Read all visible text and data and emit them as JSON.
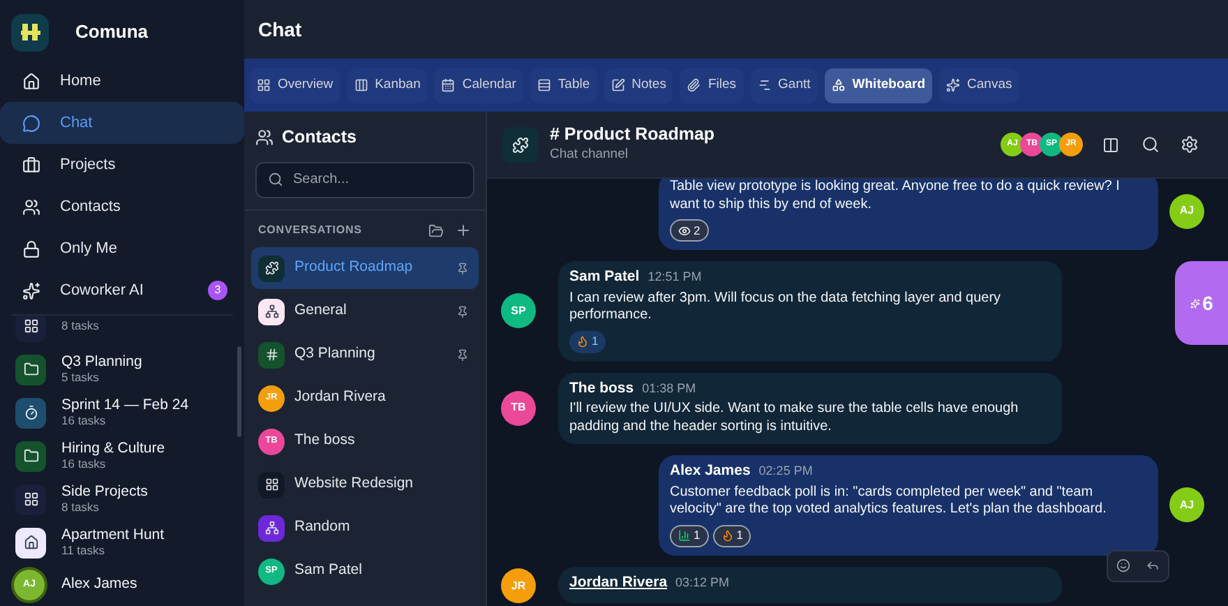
{
  "app": {
    "name": "Comuna"
  },
  "nav": [
    {
      "label": "Home",
      "selected": false
    },
    {
      "label": "Chat",
      "selected": true
    },
    {
      "label": "Projects",
      "selected": false
    },
    {
      "label": "Contacts",
      "selected": false
    },
    {
      "label": "Only Me",
      "selected": false
    },
    {
      "label": "Coworker AI",
      "selected": false,
      "badge": "3"
    }
  ],
  "projects": [
    {
      "subtitle": "8 tasks",
      "kind": "grid",
      "color": "#1a1f3a"
    },
    {
      "name": "Q3 Planning",
      "subtitle": "5 tasks",
      "kind": "folder",
      "color": "#14532d"
    },
    {
      "name": "Sprint 14 — Feb 24",
      "subtitle": "16 tasks",
      "kind": "timer",
      "color": "#1e4e6e"
    },
    {
      "name": "Hiring & Culture",
      "subtitle": "16 tasks",
      "kind": "folder",
      "color": "#14532d"
    },
    {
      "name": "Side Projects",
      "subtitle": "8 tasks",
      "kind": "grid",
      "color": "#1a1f3a"
    },
    {
      "name": "Apartment Hunt",
      "subtitle": "11 tasks",
      "kind": "home",
      "color": "#ede9fe"
    }
  ],
  "user": {
    "name": "Alex James",
    "initials": "AJ"
  },
  "page_title": "Chat",
  "tabs": [
    {
      "label": "Overview",
      "selected": false
    },
    {
      "label": "Kanban",
      "selected": false
    },
    {
      "label": "Calendar",
      "selected": false
    },
    {
      "label": "Table",
      "selected": false
    },
    {
      "label": "Notes",
      "selected": false
    },
    {
      "label": "Files",
      "selected": false
    },
    {
      "label": "Gantt",
      "selected": false
    },
    {
      "label": "Whiteboard",
      "selected": true
    },
    {
      "label": "Canvas",
      "selected": false
    }
  ],
  "contacts": {
    "title": "Contacts",
    "search": {
      "placeholder": "Search..."
    },
    "section": "CONVERSATIONS",
    "conversations": [
      {
        "name": "Product Roadmap",
        "kind": "puzzle",
        "color": "#0f2e35",
        "pinned": true,
        "selected": true
      },
      {
        "name": "General",
        "kind": "network",
        "color": "#fce7f3",
        "pinned": true,
        "selected": false
      },
      {
        "name": "Q3 Planning",
        "kind": "hash",
        "color": "#14532d",
        "pinned": true,
        "selected": false
      },
      {
        "name": "Jordan Rivera",
        "kind": "person",
        "initials": "JR",
        "color": "#f59e0b",
        "pinned": false,
        "selected": false
      },
      {
        "name": "The boss",
        "kind": "person",
        "initials": "TB",
        "color": "#ec4899",
        "pinned": false,
        "selected": false
      },
      {
        "name": "Website Redesign",
        "kind": "grid",
        "color": "#111827",
        "pinned": false,
        "selected": false
      },
      {
        "name": "Random",
        "kind": "network",
        "color": "#6d28d9",
        "pinned": false,
        "selected": false
      },
      {
        "name": "Sam Patel",
        "kind": "person",
        "initials": "SP",
        "color": "#10b981",
        "pinned": false,
        "selected": false
      }
    ]
  },
  "channel": {
    "title": "# Product Roadmap",
    "subtitle": "Chat channel",
    "members": [
      {
        "initials": "AJ",
        "color": "#84cc16"
      },
      {
        "initials": "TB",
        "color": "#ec4899"
      },
      {
        "initials": "SP",
        "color": "#10b981"
      },
      {
        "initials": "JR",
        "color": "#f59e0b"
      }
    ]
  },
  "messages": [
    {
      "own": true,
      "initials": "AJ",
      "color": "#84cc16",
      "text": "Table view prototype is looking great. Anyone free to do a quick review? I want to ship this by end of week.",
      "reactions": [
        {
          "kind": "eyes",
          "count": "2"
        }
      ]
    },
    {
      "own": false,
      "author": "Sam Patel",
      "time": "12:51 PM",
      "initials": "SP",
      "color": "#10b981",
      "text": "I can review after 3pm. Will focus on the data fetching layer and query performance.",
      "reactions": [
        {
          "kind": "fire",
          "count": "1"
        }
      ]
    },
    {
      "own": false,
      "author": "The boss",
      "time": "01:38 PM",
      "initials": "TB",
      "color": "#ec4899",
      "text": "I'll review the UI/UX side. Want to make sure the table cells have enough padding and the header sorting is intuitive."
    },
    {
      "own": true,
      "author": "Alex James",
      "time": "02:25 PM",
      "initials": "AJ",
      "color": "#84cc16",
      "text": "Customer feedback poll is in: \"cards completed per week\" and \"team velocity\" are the top voted analytics features. Let's plan the dashboard.",
      "reactions": [
        {
          "kind": "chart",
          "count": "1"
        },
        {
          "kind": "fire",
          "count": "1"
        }
      ],
      "hovered": true
    },
    {
      "own": false,
      "author": "Jordan Rivera",
      "time": "03:12 PM",
      "initials": "JR",
      "color": "#f59e0b"
    }
  ],
  "floating_badge": {
    "count": "6"
  }
}
